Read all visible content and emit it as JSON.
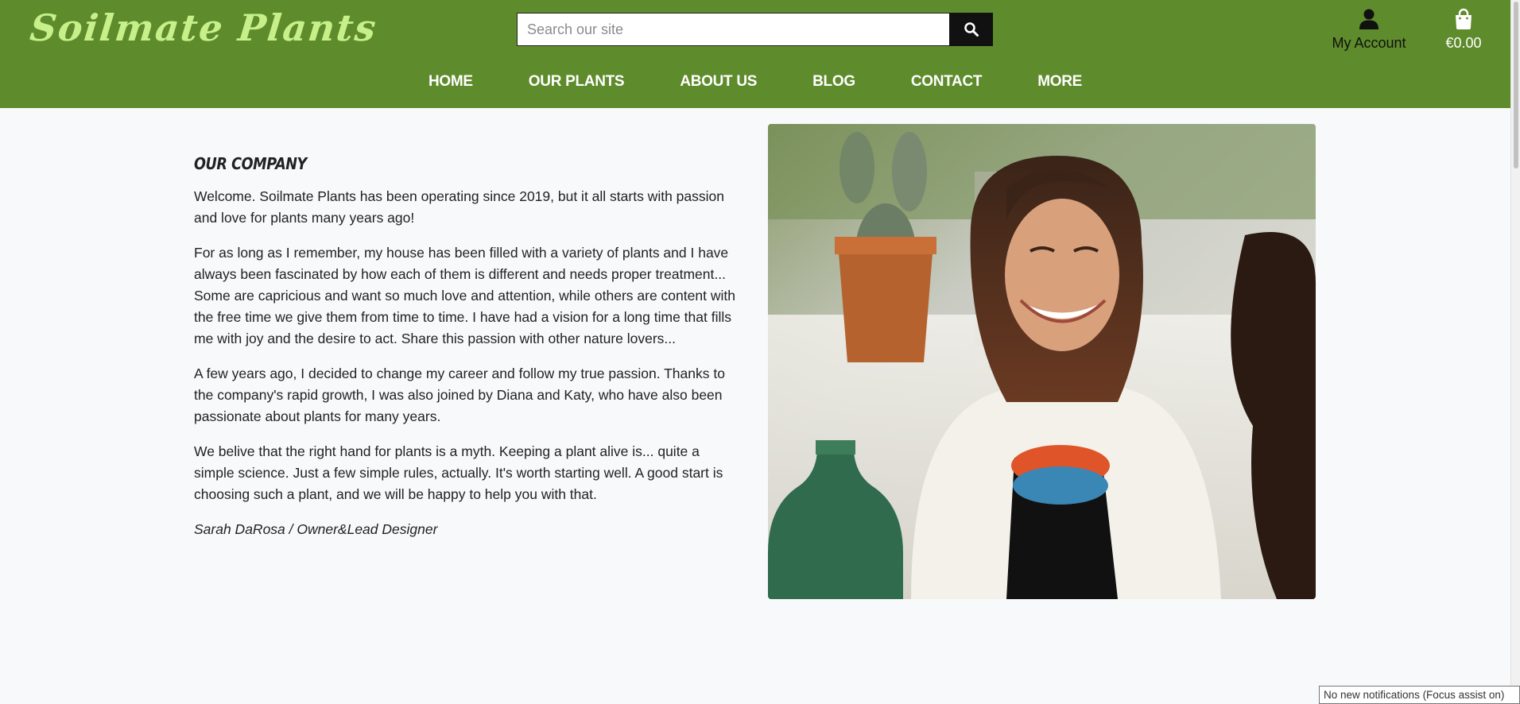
{
  "header": {
    "logo": "Soilmate Plants",
    "search": {
      "placeholder": "Search our site",
      "value": ""
    },
    "account_label": "My Account",
    "cart_total": "€0.00",
    "brand_color": "#5e8b2b",
    "logo_color": "#c7f08a"
  },
  "nav": {
    "items": [
      {
        "label": "HOME"
      },
      {
        "label": "OUR PLANTS"
      },
      {
        "label": "ABOUT US"
      },
      {
        "label": "BLOG"
      },
      {
        "label": "CONTACT"
      },
      {
        "label": "MORE"
      }
    ]
  },
  "about": {
    "heading": "OUR COMPANY",
    "paragraphs": [
      "Welcome. Soilmate Plants has been operating since 2019, but it all starts with passion and love for plants many years ago!",
      "For as long as I remember, my house has been filled with a variety of plants and I have always been fascinated by how each of them is different and needs proper treatment... Some are capricious and want so much love and attention, while others are content with the free time we give them from time to time. I have had a vision for a long time that fills me with joy and the desire to act. Share this passion with other nature lovers...",
      "A few years ago, I decided to change my career and follow my true passion. Thanks to the company's rapid growth, I was also joined by Diana and Katy, who have also been passionate about plants for many years.",
      "We belive that the right hand for plants is a myth. Keeping a plant alive is... quite a simple science. Just a few simple rules, actually. It's worth starting well. A good start is choosing such a plant, and we will be happy to help you with that."
    ],
    "signature": "Sarah DaRosa / Owner&Lead Designer"
  },
  "icons": {
    "search": "search-icon",
    "account": "user-icon",
    "cart": "shopping-bag-icon"
  },
  "system": {
    "notification": "No new notifications (Focus assist on)"
  }
}
